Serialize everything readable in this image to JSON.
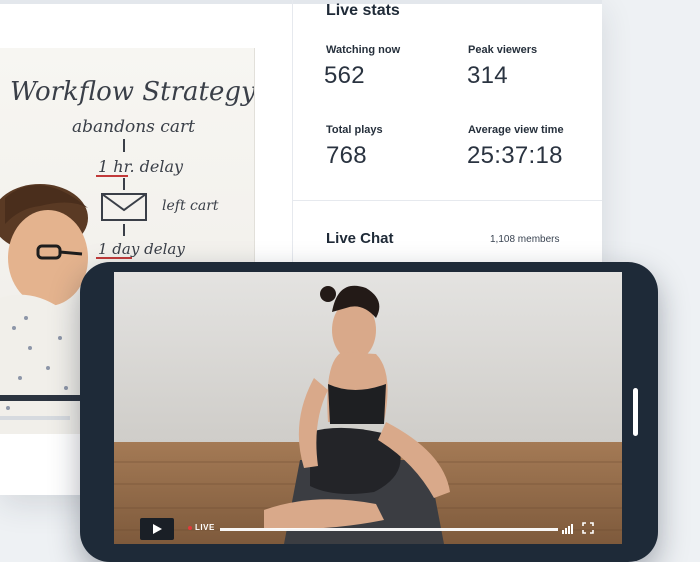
{
  "stats": {
    "title": "Live stats",
    "items": [
      {
        "label": "Watching now",
        "value": "562"
      },
      {
        "label": "Peak viewers",
        "value": "314"
      },
      {
        "label": "Total plays",
        "value": "768"
      },
      {
        "label": "Average view time",
        "value": "25:37:18"
      }
    ]
  },
  "chat": {
    "title": "Live Chat",
    "members": "1,108 members"
  },
  "whiteboard": {
    "title": "Workflow Strategy",
    "lines": [
      "abandons cart",
      "1 hr. delay",
      "left cart",
      "1 day delay"
    ]
  },
  "player": {
    "live_label": "LIVE",
    "play_icon": "play-icon",
    "signal_icon": "signal-icon",
    "fullscreen_icon": "fullscreen-icon"
  },
  "colors": {
    "phone_frame": "#1e2a38",
    "live_dot": "#e23a3a",
    "accent_red": "#c23a3a"
  }
}
